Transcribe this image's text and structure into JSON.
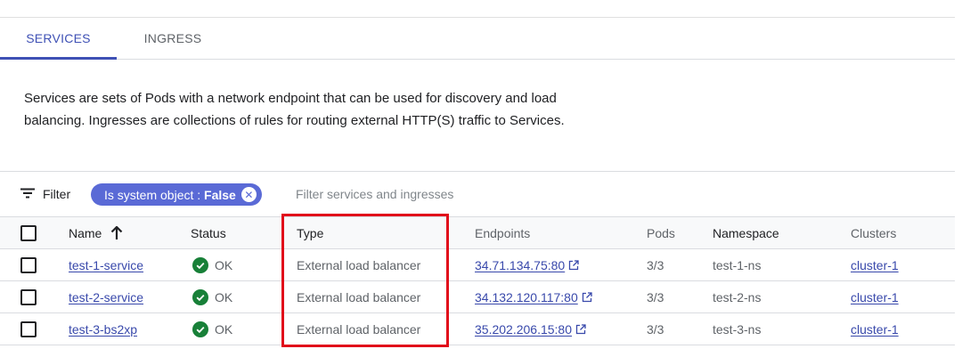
{
  "tabs": [
    {
      "label": "SERVICES",
      "active": true
    },
    {
      "label": "INGRESS",
      "active": false
    }
  ],
  "description": "Services are sets of Pods with a network endpoint that can be used for discovery and load balancing. Ingresses are collections of rules for routing external HTTP(S) traffic to Services.",
  "filter": {
    "button_label": "Filter",
    "chip_key": "Is system object : ",
    "chip_value": "False",
    "placeholder": "Filter services and ingresses",
    "icon": "filter-list-icon"
  },
  "table": {
    "headers": {
      "name": "Name",
      "status": "Status",
      "type": "Type",
      "endpoints": "Endpoints",
      "pods": "Pods",
      "namespace": "Namespace",
      "clusters": "Clusters"
    },
    "sort_icon": "arrow-up-icon",
    "rows": [
      {
        "name": "test-1-service",
        "status": "OK",
        "type": "External load balancer",
        "endpoint": "34.71.134.75:80",
        "pods": "3/3",
        "namespace": "test-1-ns",
        "cluster": "cluster-1"
      },
      {
        "name": "test-2-service",
        "status": "OK",
        "type": "External load balancer",
        "endpoint": "34.132.120.117:80",
        "pods": "3/3",
        "namespace": "test-2-ns",
        "cluster": "cluster-1"
      },
      {
        "name": "test-3-bs2xp",
        "status": "OK",
        "type": "External load balancer",
        "endpoint": "35.202.206.15:80",
        "pods": "3/3",
        "namespace": "test-3-ns",
        "cluster": "cluster-1"
      }
    ]
  },
  "colors": {
    "accent": "#3f51b5",
    "chip": "#5a6ad6",
    "ok_green": "#188038",
    "link": "#3949ab",
    "highlight": "#e10c1a"
  }
}
